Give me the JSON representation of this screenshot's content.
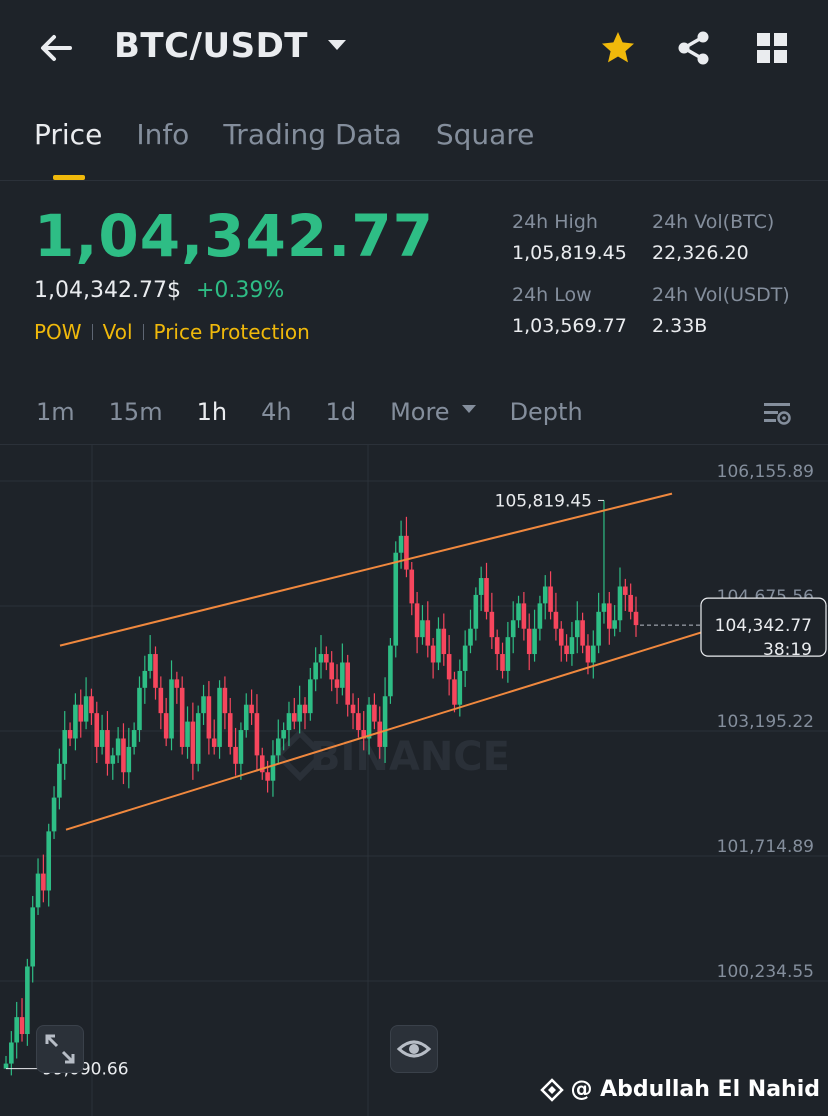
{
  "header": {
    "pair": "BTC/USDT",
    "icons": [
      "back-arrow-icon",
      "chevron-down-icon",
      "star-icon",
      "share-icon",
      "grid-icon"
    ],
    "star_color": "#f0b90b"
  },
  "tabs": [
    {
      "label": "Price",
      "active": true
    },
    {
      "label": "Info",
      "active": false
    },
    {
      "label": "Trading Data",
      "active": false
    },
    {
      "label": "Square",
      "active": false
    }
  ],
  "price": {
    "last": "1,04,342.77",
    "last_usd": "1,04,342.77$",
    "change": "+0.39%",
    "tags": [
      "POW",
      "Vol",
      "Price Protection"
    ]
  },
  "stats": {
    "high_label": "24h High",
    "high_value": "1,05,819.45",
    "vol_btc_label": "24h Vol(BTC)",
    "vol_btc_value": "22,326.20",
    "low_label": "24h Low",
    "low_value": "1,03,569.77",
    "vol_usdt_label": "24h Vol(USDT)",
    "vol_usdt_value": "2.33B"
  },
  "timeframes": {
    "items": [
      "1m",
      "15m",
      "1h",
      "4h",
      "1d",
      "More",
      "Depth"
    ],
    "active": "1h"
  },
  "chart_data": {
    "type": "candlestick",
    "interval": "1h",
    "y_ticks": [
      106155.89,
      104675.56,
      103195.22,
      101714.89,
      100234.55
    ],
    "y_tick_labels": [
      "106,155.89",
      "104,675.56",
      "103,195.22",
      "101,714.89",
      "100,234.55"
    ],
    "high_marker": "105,819.45",
    "high_value": 105819.45,
    "low_marker": "99,090.66",
    "low_value": 99090.66,
    "last_price_label": "104,342.77",
    "last_price_value": 104342.77,
    "countdown": "38:19",
    "watermark": "BINANCE",
    "up_color": "#2ebd85",
    "down_color": "#f6465d",
    "channel_color": "#f0883e",
    "channel_upper": [
      [
        60,
        104100
      ],
      [
        672,
        105900
      ]
    ],
    "channel_lower": [
      [
        66,
        101920
      ],
      [
        735,
        104380
      ]
    ],
    "closes": [
      99150,
      99400,
      99700,
      99500,
      100300,
      101000,
      101400,
      101200,
      101900,
      102300,
      102700,
      103100,
      103000,
      103400,
      103200,
      103500,
      103300,
      102900,
      103100,
      102700,
      102800,
      103000,
      102600,
      102900,
      103100,
      103600,
      103800,
      104000,
      103600,
      103300,
      103000,
      103700,
      103600,
      102900,
      103200,
      102700,
      103300,
      103500,
      103000,
      102900,
      103600,
      103300,
      102900,
      102700,
      103100,
      103400,
      103300,
      102800,
      102600,
      102500,
      102800,
      103000,
      103100,
      103300,
      103200,
      103400,
      103300,
      103700,
      103900,
      104000,
      103900,
      103700,
      103600,
      103900,
      103400,
      103300,
      103100,
      103000,
      103400,
      103200,
      102900,
      103500,
      104100,
      105200,
      105400,
      105000,
      104600,
      104200,
      104400,
      104100,
      103900,
      104300,
      104000,
      103700,
      103400,
      103800,
      104100,
      104300,
      104700,
      104900,
      104500,
      104200,
      104000,
      103800,
      104200,
      104400,
      104600,
      104300,
      104000,
      104300,
      104600,
      104800,
      104500,
      104300,
      104100,
      104000,
      104200,
      104400,
      104100,
      103900,
      104100,
      104500,
      104600,
      104300,
      104400,
      104800,
      104700,
      104500,
      104342.77
    ]
  },
  "credit": {
    "text": "@ Abdullah El Nahid"
  }
}
